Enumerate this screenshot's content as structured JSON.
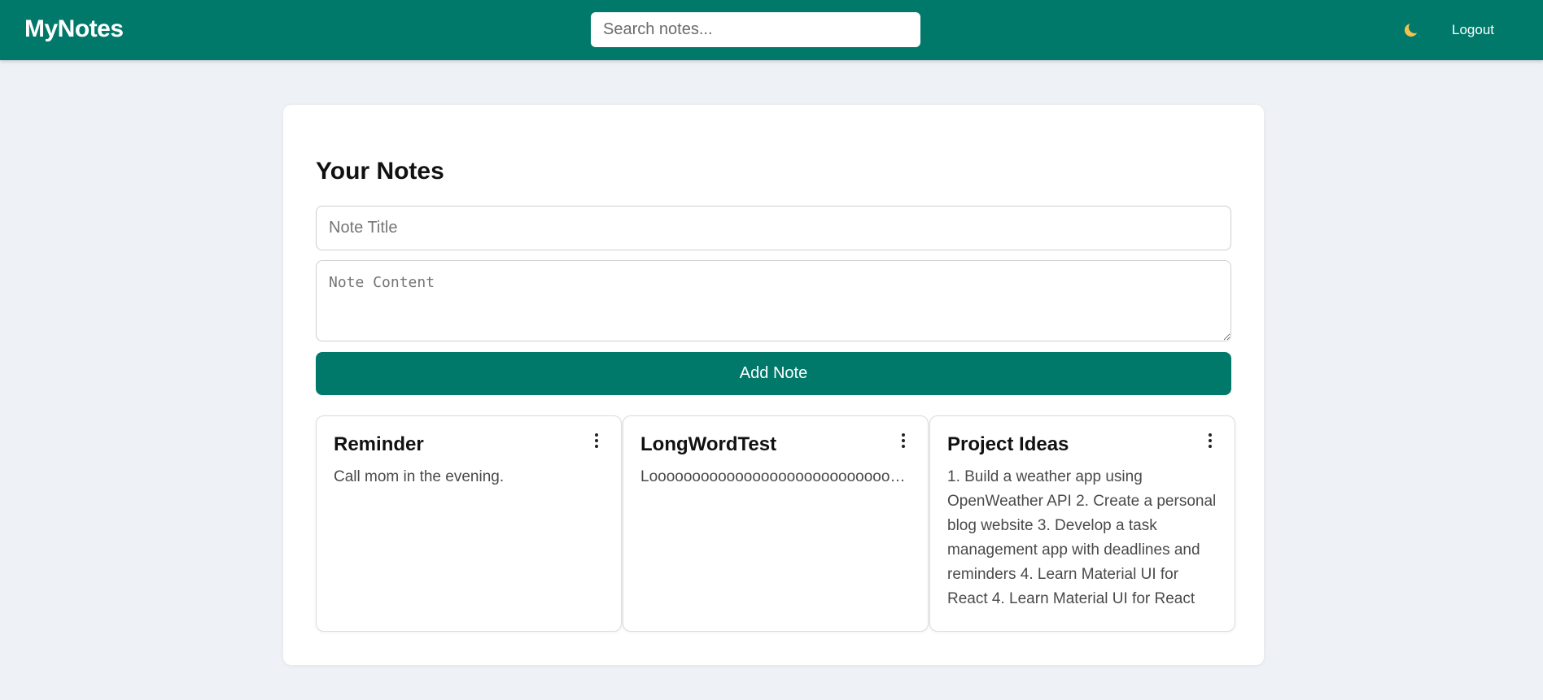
{
  "navbar": {
    "brand": "MyNotes",
    "search_placeholder": "Search notes...",
    "theme_icon": "moon-icon",
    "logout_label": "Logout"
  },
  "main": {
    "heading": "Your Notes",
    "title_placeholder": "Note Title",
    "content_placeholder": "Note Content",
    "add_button_label": "Add Note"
  },
  "notes": [
    {
      "title": "Reminder",
      "content": "Call mom in the evening."
    },
    {
      "title": "LongWordTest",
      "content": "Loooooooooooooooooooooooooooooooooooooooooooooooooooooooooooooooooooooooooooooooooooooooooooooooooong"
    },
    {
      "title": "Project Ideas",
      "content": "1. Build a weather app using OpenWeather API 2. Create a personal blog website 3. Develop a task management app with deadlines and reminders 4. Learn Material UI for React 4. Learn Material UI for React"
    }
  ],
  "colors": {
    "primary": "#00796b",
    "background": "#eef1f5",
    "card": "#ffffff",
    "moon": "#f2c14e"
  }
}
